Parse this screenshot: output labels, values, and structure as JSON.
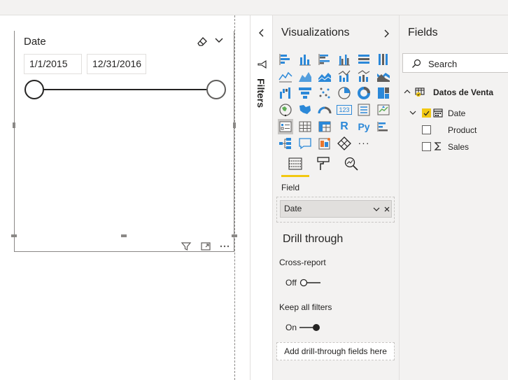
{
  "slicer": {
    "title": "Date",
    "start_date": "1/1/2015",
    "end_date": "12/31/2016",
    "range_fraction": {
      "start": 0.0,
      "end": 1.0
    }
  },
  "filters": {
    "label": "Filters"
  },
  "visualizations": {
    "title": "Visualizations",
    "field_label": "Field",
    "field_value": "Date",
    "visual_icons": [
      "stacked-bar-icon",
      "stacked-column-icon",
      "clustered-bar-icon",
      "clustered-column-icon",
      "100-stacked-bar-icon",
      "100-stacked-column-icon",
      "line-chart-icon",
      "area-chart-icon",
      "stacked-area-icon",
      "line-column-icon",
      "line-stacked-column-icon",
      "ribbon-chart-icon",
      "waterfall-icon",
      "funnel-icon",
      "scatter-icon",
      "pie-icon",
      "donut-icon",
      "treemap-icon",
      "map-icon",
      "filled-map-icon",
      "gauge-icon",
      "card-icon",
      "multirow-card-icon",
      "kpi-icon",
      "slicer-icon",
      "table-icon",
      "matrix-icon",
      "r-visual-icon",
      "python-visual-icon",
      "key-influencers-icon",
      "decomposition-tree-icon",
      "qna-icon",
      "smart-narrative-icon",
      "arcgis-icon",
      "more-icon"
    ],
    "more_glyph": "···",
    "r_glyph": "R",
    "py_glyph": "Py",
    "card_glyph": "123"
  },
  "drill": {
    "title": "Drill through",
    "cross_report_label": "Cross-report",
    "cross_report_state": "Off",
    "keep_filters_label": "Keep all filters",
    "keep_filters_state": "On",
    "add_fields_label": "Add drill-through fields here"
  },
  "fields": {
    "title": "Fields",
    "search_placeholder": "Search",
    "table_name": "Datos de Venta",
    "items": [
      {
        "name": "Date",
        "checked": true
      },
      {
        "name": "Product",
        "checked": false
      },
      {
        "name": "Sales",
        "checked": false
      }
    ]
  },
  "colors": {
    "accent": "#f2c811",
    "pane_bg": "#f3f2f1",
    "icon_blue": "#2b88d8",
    "text": "#252423"
  }
}
